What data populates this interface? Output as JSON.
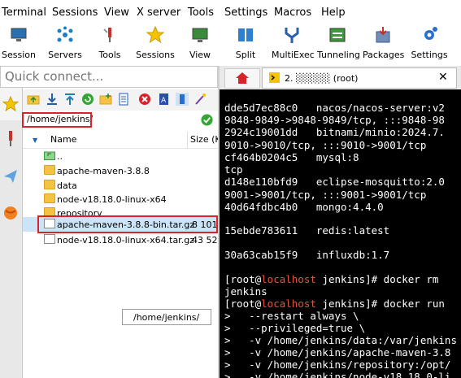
{
  "menu": [
    "Terminal",
    "Sessions",
    "View",
    "X server",
    "Tools",
    "Settings",
    "Macros",
    "Help"
  ],
  "toolbar": [
    {
      "label": "Session",
      "icon": "monitor-icon"
    },
    {
      "label": "Servers",
      "icon": "servers-icon"
    },
    {
      "label": "Tools",
      "icon": "tools-icon"
    },
    {
      "label": "Sessions",
      "icon": "star-icon"
    },
    {
      "label": "View",
      "icon": "view-icon"
    },
    {
      "label": "Split",
      "icon": "split-icon"
    },
    {
      "label": "MultiExec",
      "icon": "multiexec-icon"
    },
    {
      "label": "Tunneling",
      "icon": "tunneling-icon"
    },
    {
      "label": "Packages",
      "icon": "packages-icon"
    },
    {
      "label": "Settings",
      "icon": "gear-icon"
    }
  ],
  "quick_connect": {
    "placeholder": "Quick connect..."
  },
  "file_browser": {
    "path": "/home/jenkins/",
    "columns": {
      "name": "Name",
      "size": "Size (K"
    },
    "items": [
      {
        "name": "..",
        "size": "",
        "type": "parent"
      },
      {
        "name": "apache-maven-3.8.8",
        "size": "",
        "type": "folder"
      },
      {
        "name": "data",
        "size": "",
        "type": "folder"
      },
      {
        "name": "node-v18.18.0-linux-x64",
        "size": "",
        "type": "folder"
      },
      {
        "name": "repository",
        "size": "",
        "type": "folder"
      },
      {
        "name": "apache-maven-3.8.8-bin.tar.gz",
        "size": "8 101",
        "type": "file"
      },
      {
        "name": "node-v18.18.0-linux-x64.tar.gz",
        "size": "43 52",
        "type": "file"
      }
    ],
    "tooltip": "/home/jenkins/"
  },
  "terminal_tab": {
    "label": "2. ░░░░░ (root)"
  },
  "terminal_lines": [
    "dde5d7ec88c0   nacos/nacos-server:v2",
    "9848-9849->9848-9849/tcp, :::9848-98",
    "2924c19001dd   bitnami/minio:2024.7.",
    "9010->9010/tcp, :::9010->9001/tcp",
    "cf464b0204c5   mysql:8",
    "tcp",
    "d148e110bfd9   eclipse-mosquitto:2.0",
    "9001->9001/tcp, :::9001->9001/tcp",
    "40d64fdbc4b0   mongo:4.4.0",
    "",
    "15ebde783611   redis:latest",
    "",
    "30a63cab15f9   influxdb:1.7",
    "",
    "[root@localhost jenkins]# docker rm",
    "jenkins",
    "[root@localhost jenkins]# docker run",
    ">   --restart always \\",
    ">   --privileged=true \\",
    ">   -v /home/jenkins/data:/var/jenkins",
    ">   -v /home/jenkins/apache-maven-3.8",
    ">   -v /home/jenkins/repository:/opt/",
    ">   -v /home/jenkins/node-v18.18.0-li"
  ],
  "colors": {
    "highlight_box": "#d8232a",
    "terminal_bg": "#000000",
    "prompt_host": "#e0553f",
    "selected_row": "#cce4f7"
  }
}
